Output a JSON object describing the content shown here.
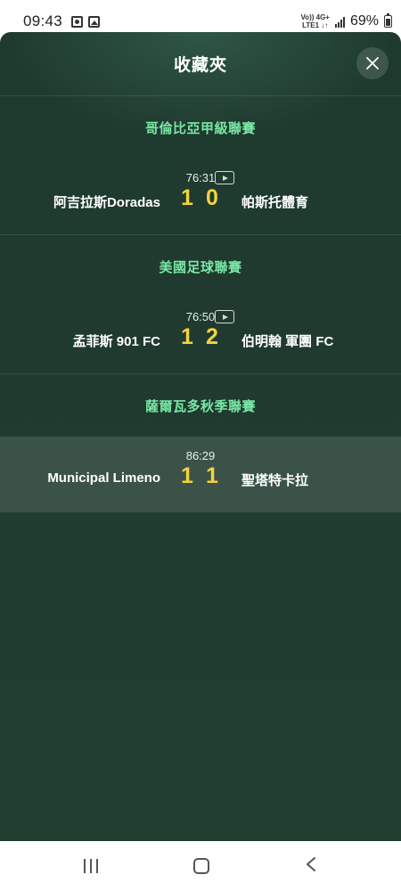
{
  "status_bar": {
    "time": "09:43",
    "network_top": "Vo)) 4G+",
    "network_bottom": "LTE1 ↓↑",
    "battery_percent": "69%"
  },
  "panel": {
    "title": "收藏夾",
    "close_icon": "close-icon"
  },
  "leagues": [
    {
      "name": "哥倫比亞甲級聯賽",
      "match": {
        "time": "76:31",
        "home": "阿吉拉斯Doradas",
        "home_score": "1",
        "away_score": "0",
        "away": "帕斯托體育",
        "has_video": true
      }
    },
    {
      "name": "美國足球聯賽",
      "match": {
        "time": "76:50",
        "home": "孟菲斯 901 FC",
        "home_score": "1",
        "away_score": "2",
        "away": "伯明翰 軍團 FC",
        "has_video": true
      }
    },
    {
      "name": "薩爾瓦多秋季聯賽",
      "match": {
        "time": "86:29",
        "home": "Municipal Limeno",
        "home_score": "1",
        "away_score": "1",
        "away": "聖塔特卡拉",
        "has_video": false
      }
    }
  ],
  "colors": {
    "league_title": "#79e6a4",
    "score": "#f4d23e",
    "panel_bg": "#203a2f"
  }
}
